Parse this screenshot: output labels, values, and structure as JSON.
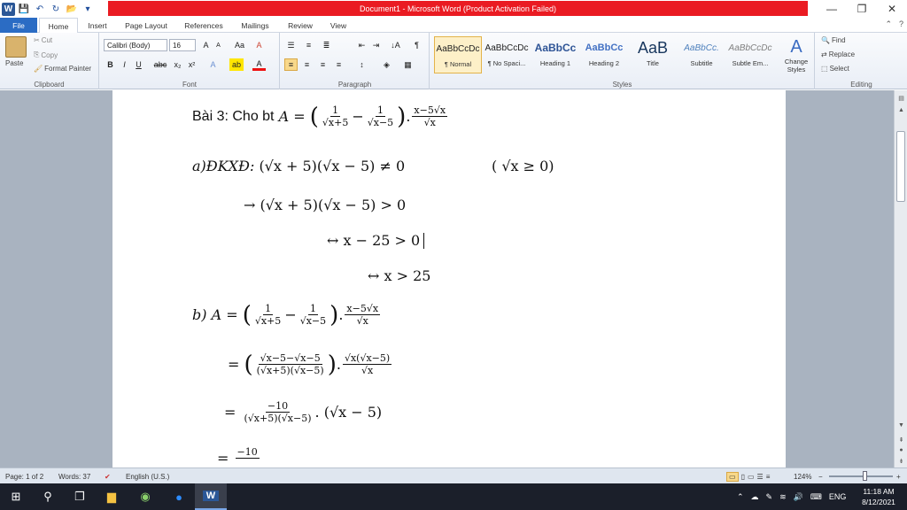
{
  "window": {
    "title": "Document1  -  Microsoft Word (Product Activation Failed)",
    "controls": {
      "minimize": "—",
      "restore": "❐",
      "close": "✕"
    }
  },
  "qat": {
    "word_icon": "W",
    "save": "💾",
    "undo": "↶",
    "redo": "↻",
    "open": "📂",
    "customize": "▾"
  },
  "tabs": [
    {
      "label": "File"
    },
    {
      "label": "Home"
    },
    {
      "label": "Insert"
    },
    {
      "label": "Page Layout"
    },
    {
      "label": "References"
    },
    {
      "label": "Mailings"
    },
    {
      "label": "Review"
    },
    {
      "label": "View"
    }
  ],
  "ribbon": {
    "clipboard": {
      "paste": "Paste",
      "cut": "Cut",
      "copy": "Copy",
      "format_painter": "Format Painter",
      "label": "Clipboard"
    },
    "font": {
      "name": "Calibri (Body)",
      "size": "16",
      "grow": "A",
      "shrink": "A",
      "case": "Aa",
      "clear": "A",
      "bold": "B",
      "italic": "I",
      "underline": "U",
      "strike": "abc",
      "sub": "x₂",
      "sup": "x²",
      "effects": "A",
      "highlight": "ab",
      "color": "A",
      "label": "Font"
    },
    "paragraph": {
      "label": "Paragraph",
      "show": "¶",
      "sort": "↓A"
    },
    "styles": {
      "label": "Styles",
      "items": [
        {
          "preview": "AaBbCcDc",
          "name": "¶ Normal"
        },
        {
          "preview": "AaBbCcDc",
          "name": "¶ No Spaci..."
        },
        {
          "preview": "AaBbCc",
          "name": "Heading 1"
        },
        {
          "preview": "AaBbCc",
          "name": "Heading 2"
        },
        {
          "preview": "AaB",
          "name": "Title"
        },
        {
          "preview": "AaBbCc.",
          "name": "Subtitle"
        },
        {
          "preview": "AaBbCcDc",
          "name": "Subtle Em..."
        }
      ],
      "change_styles": "Change Styles"
    },
    "editing": {
      "find": "Find",
      "replace": "Replace",
      "select": "Select",
      "label": "Editing"
    }
  },
  "document": {
    "l1_label": "Bài 3: Cho bt",
    "l1_lhs": "A =",
    "f_one": "1",
    "den_plus": "√x+5",
    "den_minus": "√x−5",
    "minus": "−",
    "dot": ".",
    "num_x5": "x−5√x",
    "den_sqrtx": "√x",
    "l2_label": "a)ĐKXĐ:",
    "l2_expr": "(√x + 5)(√x − 5) ≠ 0",
    "l2_cond": "( √x  ≥ 0)",
    "l3_expr": "→ (√x + 5)(√x − 5) > 0",
    "l4_expr": "↔ x − 25 > 0",
    "l5_expr": "↔ x > 25",
    "l6_label": "b) A =",
    "l7_eq": "=",
    "l7_num": "√x−5−√x−5",
    "l7_den": "(√x+5)(√x−5)",
    "l7_num2": "√x(√x−5)",
    "l8_num": "−10",
    "l8_den": "(√x+5)(√x−5)",
    "l8_tail": ". (√x − 5)",
    "l9_num": "−10"
  },
  "status": {
    "page": "Page: 1 of 2",
    "words": "Words: 37",
    "language": "English (U.S.)",
    "zoom": "124%",
    "zoom_minus": "−",
    "zoom_plus": "+"
  },
  "taskbar": {
    "lang": "ENG",
    "time": "11:18 AM",
    "date": "8/12/2021"
  }
}
